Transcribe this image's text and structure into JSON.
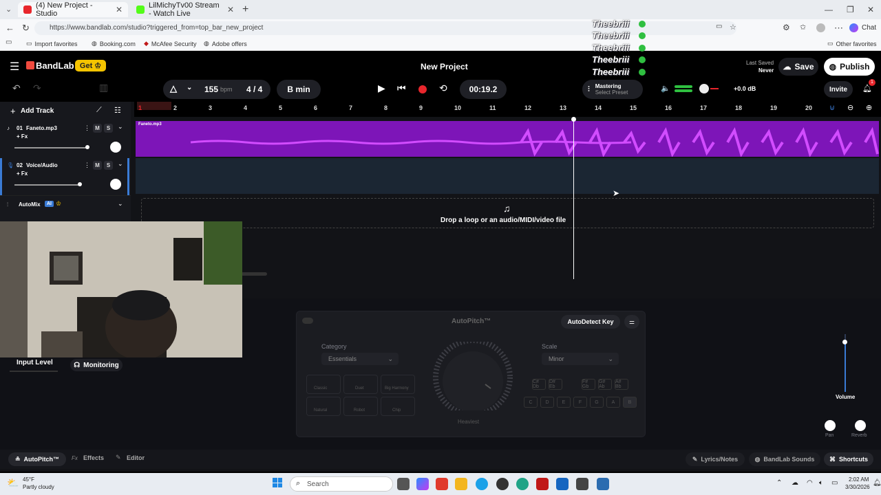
{
  "browser": {
    "tabs": [
      {
        "label": "(4) New Project - Studio"
      },
      {
        "label": "LilMichyTv00 Stream - Watch Live"
      }
    ],
    "url": "https://www.bandlab.com/studio?triggered_from=top_bar_new_project",
    "chat_label": "Chat",
    "favorites": [
      "Import favorites",
      "Booking.com",
      "McAfee Security",
      "Adobe offers"
    ],
    "other_favorites": "Other favorites"
  },
  "app": {
    "brand": "BandLab",
    "get_label": "Get",
    "project_title": "New Project",
    "last_saved_label": "Last Saved",
    "last_saved_value": "Never",
    "save_label": "Save",
    "publish_label": "Publish",
    "invite_label": "Invite",
    "notification_count": "1",
    "bpm_value": "155",
    "bpm_unit": "bpm",
    "time_sig": "4 / 4",
    "key": "B min",
    "timer": "00:19.2",
    "mastering_label": "Mastering",
    "mastering_preset": "Select Preset",
    "output_db": "+0.0 dB"
  },
  "tracks": {
    "add_track": "Add Track",
    "items": [
      {
        "number": "01",
        "name": "Faneto.mp3",
        "fx": "+ Fx",
        "m": "M",
        "s": "S",
        "region_label": "Faneto.mp3"
      },
      {
        "number": "02",
        "name": "Voice/Audio",
        "fx": "+ Fx",
        "m": "M",
        "s": "S"
      }
    ],
    "automix_label": "AutoMix",
    "automix_badge": "AI"
  },
  "ruler": [
    "1",
    "2",
    "3",
    "4",
    "5",
    "6",
    "7",
    "8",
    "9",
    "10",
    "11",
    "12",
    "13",
    "14",
    "15",
    "16",
    "17",
    "18",
    "19",
    "20"
  ],
  "dropzone_text": "Drop a loop or an audio/MIDI/video file",
  "chat_overlay": [
    "Theebriii",
    "Theebriii",
    "Theebriii",
    "Theebriii",
    "Theebriii"
  ],
  "autopitch": {
    "title": "AutoPitch™",
    "autodetect": "AutoDetect Key",
    "category_label": "Category",
    "category_value": "Essentials",
    "scale_label": "Scale",
    "scale_value": "Minor",
    "modes": [
      "Classic",
      "Duet",
      "Big Harmony",
      "Natural",
      "Robot",
      "Chip"
    ],
    "knob_label": "Heaviest",
    "keys_top": [
      "C#\nDb",
      "D#\nEb",
      "F#\nGb",
      "G#\nAb",
      "A#\nBb"
    ],
    "keys_bottom": [
      "C",
      "D",
      "E",
      "F",
      "G",
      "A",
      "B"
    ]
  },
  "mixer": {
    "volume_label": "Volume",
    "pan_label": "Pan",
    "reverb_label": "Reverb",
    "input_level_label": "Input Level",
    "monitoring_label": "Monitoring"
  },
  "bottom_tabs": {
    "autopitch": "AutoPitch™",
    "effects": "Effects",
    "editor": "Editor",
    "lyrics": "Lyrics/Notes",
    "sounds": "BandLab Sounds",
    "shortcuts": "Shortcuts"
  },
  "taskbar": {
    "temp": "45°F",
    "weather": "Partly cloudy",
    "search": "Search",
    "time": "2:02 AM",
    "date": "3/30/2026"
  },
  "colors": {
    "region_purple": "#7d15b8",
    "wave_pink": "#d24cff",
    "accent_yellow": "#f5c400",
    "brand_red": "#f04a3e",
    "record_red": "#e8262c"
  }
}
